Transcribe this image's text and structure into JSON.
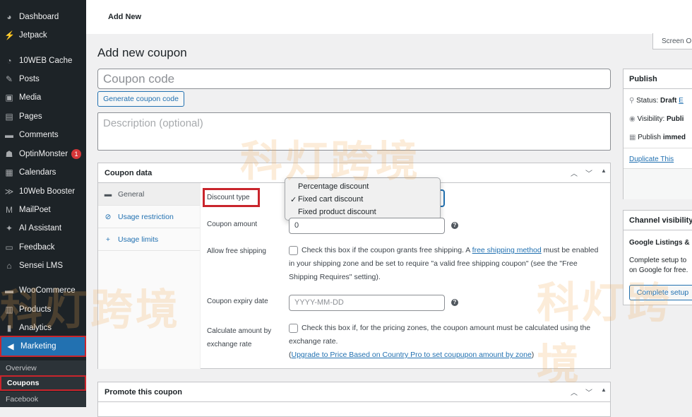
{
  "sidebar": {
    "items": [
      {
        "label": "Dashboard",
        "icon": "dashboard-icon"
      },
      {
        "label": "Jetpack",
        "icon": "jetpack-icon"
      },
      {
        "label": "10WEB Cache",
        "icon": "cache-icon"
      },
      {
        "label": "Posts",
        "icon": "pin-icon"
      },
      {
        "label": "Media",
        "icon": "media-icon"
      },
      {
        "label": "Pages",
        "icon": "pages-icon"
      },
      {
        "label": "Comments",
        "icon": "comment-icon"
      },
      {
        "label": "OptinMonster",
        "icon": "monster-icon",
        "badge": "1"
      },
      {
        "label": "Calendars",
        "icon": "calendar-icon"
      },
      {
        "label": "10Web Booster",
        "icon": "booster-icon"
      },
      {
        "label": "MailPoet",
        "icon": "mailpoet-icon"
      },
      {
        "label": "AI Assistant",
        "icon": "sparkle-icon"
      },
      {
        "label": "Feedback",
        "icon": "feedback-icon"
      },
      {
        "label": "Sensei LMS",
        "icon": "sensei-icon"
      },
      {
        "label": "WooCommerce",
        "icon": "woo-icon"
      },
      {
        "label": "Products",
        "icon": "products-icon"
      },
      {
        "label": "Analytics",
        "icon": "analytics-icon"
      },
      {
        "label": "Marketing",
        "icon": "megaphone-icon"
      }
    ],
    "submenu": [
      "Overview",
      "Coupons",
      "Facebook"
    ]
  },
  "topbar": {
    "title": "Add New",
    "screen_options": "Screen O"
  },
  "page": {
    "title": "Add new coupon",
    "coupon_code_placeholder": "Coupon code",
    "generate_button": "Generate coupon code",
    "description_placeholder": "Description (optional)"
  },
  "coupon_data": {
    "title": "Coupon data",
    "tabs": [
      "General",
      "Usage restriction",
      "Usage limits"
    ],
    "discount_type_label": "Discount type",
    "dropdown": {
      "options": [
        "Percentage discount",
        "Fixed cart discount",
        "Fixed product discount"
      ],
      "selected": "Fixed cart discount",
      "check": "✓"
    },
    "coupon_amount_label": "Coupon amount",
    "coupon_amount_value": "0",
    "free_shipping_label": "Allow free shipping",
    "free_shipping_text_1": "Check this box if the coupon grants free shipping. A ",
    "free_shipping_link": "free shipping method",
    "free_shipping_text_2": " must be enabled in your shipping zone and be set to require \"a valid free shipping coupon\" (see the \"Free Shipping Requires\" setting).",
    "expiry_label": "Coupon expiry date",
    "expiry_placeholder": "YYYY-MM-DD",
    "exchange_label": "Calculate amount by exchange rate",
    "exchange_text": "Check this box if, for the pricing zones, the coupon amount must be calculated using the exchange rate.",
    "upgrade_open": "(",
    "upgrade_link": "Upgrade to Price Based on Country Pro to set coupupon amount by zone",
    "upgrade_close": ")"
  },
  "promote": {
    "title": "Promote this coupon"
  },
  "publish": {
    "title": "Publish",
    "status_label": "Status: ",
    "status_value": "Draft",
    "status_edit": "E",
    "visibility_label": "Visibility: ",
    "visibility_value": "Publi",
    "publish_label": "Publish ",
    "publish_value": "immed",
    "duplicate": "Duplicate This"
  },
  "channel": {
    "title": "Channel visibility",
    "subtitle": "Google Listings &",
    "text": "Complete setup to on Google for free.",
    "button": "Complete setup"
  },
  "watermark": "科灯跨境"
}
